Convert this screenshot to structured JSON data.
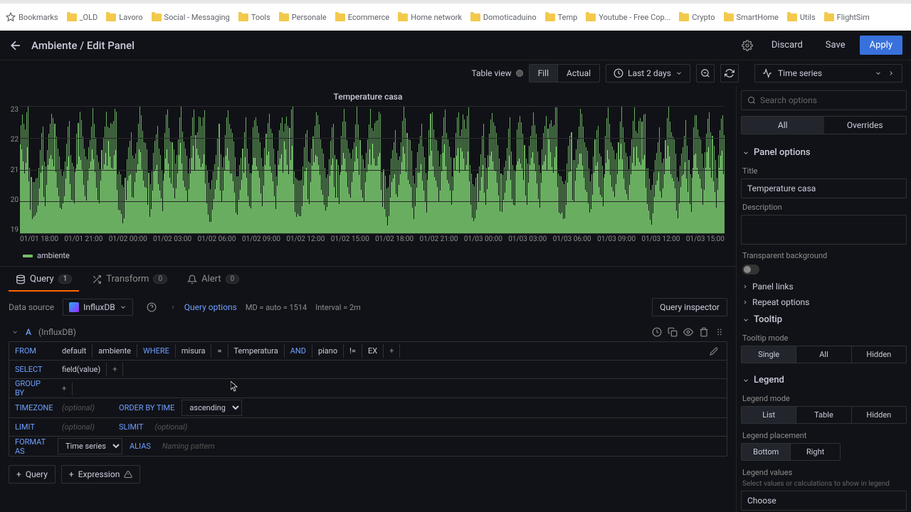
{
  "bookmarks": [
    "Bookmarks",
    "_OLD",
    "Lavoro",
    "Social - Messaging",
    "Tools",
    "Personale",
    "Ecommerce",
    "Home network",
    "Domoticaduino",
    "Temp",
    "Youtube - Free Cop...",
    "Crypto",
    "SmartHome",
    "Utils",
    "FlightSim"
  ],
  "header": {
    "breadcrumb": "Ambiente / Edit Panel",
    "discard": "Discard",
    "save": "Save",
    "apply": "Apply"
  },
  "toolbar": {
    "table_view": "Table view",
    "fill": "Fill",
    "actual": "Actual",
    "time_range": "Last 2 days",
    "viz": "Time series"
  },
  "chart": {
    "title": "Temperature casa",
    "legend": "ambiente"
  },
  "tabs": {
    "query": "Query",
    "query_count": "1",
    "transform": "Transform",
    "transform_count": "0",
    "alert": "Alert",
    "alert_count": "0"
  },
  "qtoolbar": {
    "ds_label": "Data source",
    "ds_name": "InfluxDB",
    "options": "Query options",
    "md": "MD = auto = 1514",
    "interval": "Interval = 2m",
    "inspector": "Query inspector"
  },
  "query": {
    "letter": "A",
    "subtitle": "(InfluxDB)",
    "from": "FROM",
    "default": "default",
    "measurement": "ambiente",
    "where": "WHERE",
    "tag1": "misura",
    "eq": "=",
    "val1": "Temperatura",
    "and": "AND",
    "tag2": "piano",
    "neq": "!=",
    "val2": "EX",
    "plus": "+",
    "select": "SELECT",
    "field": "field(value)",
    "groupby": "GROUP BY",
    "timezone": "TIMEZONE",
    "optional": "(optional)",
    "orderby": "ORDER BY TIME",
    "asc": "ascending",
    "limit": "LIMIT",
    "slimit": "SLIMIT",
    "format": "FORMAT AS",
    "ts": "Time series",
    "alias": "ALIAS",
    "naming": "Naming pattern"
  },
  "add": {
    "query": "Query",
    "expr": "Expression"
  },
  "right": {
    "search_ph": "Search options",
    "all": "All",
    "overrides": "Overrides",
    "panel_options": "Panel options",
    "title_label": "Title",
    "title_val": "Temperature casa",
    "desc_label": "Description",
    "transparent": "Transparent background",
    "panel_links": "Panel links",
    "repeat": "Repeat options",
    "tooltip": "Tooltip",
    "tooltip_mode": "Tooltip mode",
    "single": "Single",
    "all2": "All",
    "hidden": "Hidden",
    "legend": "Legend",
    "legend_mode": "Legend mode",
    "list": "List",
    "table": "Table",
    "hidden2": "Hidden",
    "legend_placement": "Legend placement",
    "bottom": "Bottom",
    "right_pos": "Right",
    "legend_values": "Legend values",
    "legend_values_sub": "Select values or calculations to show in legend",
    "choose": "Choose"
  },
  "chart_data": {
    "type": "line",
    "title": "Temperature casa",
    "ylabel": "",
    "ylim": [
      19,
      23
    ],
    "y_ticks": [
      23,
      22,
      21,
      20,
      19
    ],
    "x_ticks": [
      "01/01 18:00",
      "01/01 21:00",
      "01/02 00:00",
      "01/02 03:00",
      "01/02 06:00",
      "01/02 09:00",
      "01/02 12:00",
      "01/02 15:00",
      "01/02 18:00",
      "01/02 21:00",
      "01/03 00:00",
      "01/03 03:00",
      "01/03 06:00",
      "01/03 09:00",
      "01/03 12:00",
      "01/03 15:00"
    ],
    "series": [
      {
        "name": "ambiente",
        "color": "#73bf69",
        "values": [
          21.8,
          22.3,
          21.5,
          22.6,
          21.2,
          22.5,
          21.0,
          22.4,
          21.3,
          22.8,
          21.6,
          22.9,
          20.5,
          21.0,
          19.8,
          20.9,
          19.6,
          20.7,
          19.5,
          20.5,
          19.4,
          20.6,
          19.6,
          20.8,
          20.0,
          21.2,
          20.5,
          21.6,
          20.8,
          22.0,
          21.0,
          22.3,
          20.2,
          21.4,
          20.0,
          21.2,
          20.5,
          21.5,
          21.0,
          22.0,
          21.3,
          22.5,
          21.6,
          22.9,
          21.4,
          22.6,
          21.0,
          22.3,
          20.8,
          22.0,
          20.5,
          21.8,
          20.3,
          21.5,
          19.8,
          20.9,
          19.6,
          20.7,
          19.9,
          21.0,
          20.3,
          21.4,
          20.8,
          21.8,
          21.0,
          22.2,
          21.3,
          22.5,
          20.6,
          21.6,
          20.2,
          21.3,
          20.0,
          21.0,
          19.8,
          20.8,
          21.0,
          22.2,
          21.3,
          22.6,
          21.5,
          22.8,
          21.2,
          22.4,
          20.9,
          22.0,
          20.6,
          21.8,
          20.3,
          21.5,
          20.0,
          21.2,
          20.5,
          21.6,
          21.0,
          22.0,
          21.4,
          22.5,
          21.7,
          22.9,
          21.2,
          22.3,
          20.8,
          22.0,
          20.5,
          21.6,
          20.2,
          21.3,
          19.9,
          20.9,
          20.5,
          21.5,
          21.0,
          22.1,
          21.3,
          22.5,
          21.6,
          22.8,
          21.0,
          22.2
        ]
      }
    ]
  }
}
